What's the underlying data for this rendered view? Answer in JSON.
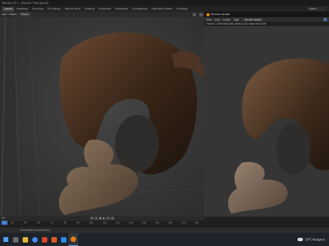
{
  "window": {
    "title": "Blender [C:\\...\\Render Tiles.blend]"
  },
  "workspaces": [
    "Layout",
    "Modeling",
    "Sculpting",
    "UV Editing",
    "Texture Paint",
    "Shading",
    "Animation",
    "Rendering",
    "Compositing",
    "Geometry Nodes",
    "Scripting"
  ],
  "scene": {
    "label": "Scene"
  },
  "viewport_header": {
    "add": "Add",
    "object": "Object",
    "orientation": "Global"
  },
  "render_window": {
    "title": "Blender Render",
    "menu": {
      "view": "View",
      "view_label": "View",
      "image": "Image",
      "slot": "Slot",
      "render_result": "Render Result"
    },
    "status": "Frame:1 | Time:00:04.88 | Mem:21.32, Peak 2357.01M"
  },
  "timeline": {
    "label": "ifer",
    "ticks": [
      "40",
      "50",
      "60",
      "70",
      "80",
      "90",
      "100",
      "110",
      "120",
      "130",
      "140",
      "150",
      "160",
      "170",
      "180"
    ],
    "current_frame": "1"
  },
  "statusbar": {
    "text": "Drop Model Context Menu"
  },
  "taskbar": {
    "apps": [
      {
        "name": "search-app",
        "color": "#6b6b6b"
      },
      {
        "name": "file-explorer",
        "color": "#e7b53b"
      },
      {
        "name": "chrome",
        "color": "#4a8af4"
      },
      {
        "name": "app-red",
        "color": "#d9452f"
      },
      {
        "name": "app-orange",
        "color": "#e05a2b"
      },
      {
        "name": "photos",
        "color": "#2c8ae8"
      },
      {
        "name": "blender",
        "color": "#e87d0d"
      }
    ],
    "weather": "14°C  Nuageux"
  }
}
